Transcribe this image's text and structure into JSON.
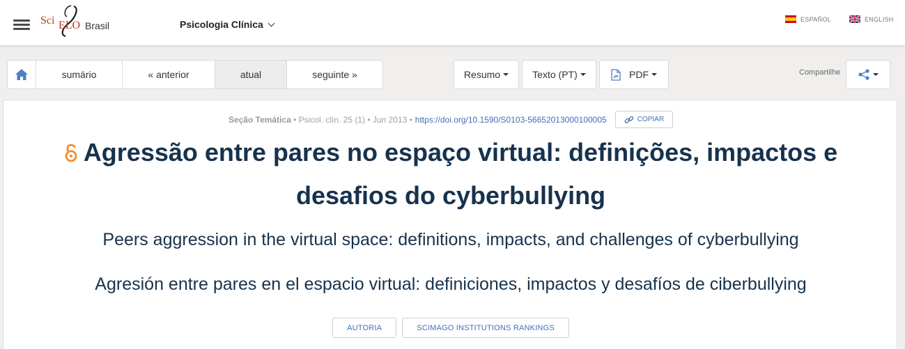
{
  "header": {
    "logo": {
      "sci": "Sci",
      "elo": "ELO",
      "country": "Brasil"
    },
    "journal": "Psicologia Clínica",
    "languages": [
      {
        "label": "ESPAÑOL",
        "flag": "es-flag-icon"
      },
      {
        "label": "ENGLISH",
        "flag": "uk-flag-icon"
      }
    ]
  },
  "nav": {
    "home_icon": "home-icon",
    "sumario": "sumário",
    "anterior": "« anterior",
    "atual": "atual",
    "seguinte": "seguinte »"
  },
  "toolbar": {
    "resumo": "Resumo",
    "texto": "Texto (PT)",
    "pdf": "PDF",
    "pdf_icon": "pdf-icon",
    "share_label": "Compartilhe",
    "share_icon": "share-icon"
  },
  "article": {
    "section": "Seção Temática",
    "citation": " • Psicol. clín. 25 (1) • Jun 2013 •",
    "doi": "https://doi.org/10.1590/S0103-56652013000100005",
    "copy_label": "COPIAR",
    "title": "Agressão entre pares no espaço virtual: definições, impactos e desafios do cyberbullying",
    "title_en": "Peers aggression in the virtual space: definitions, impacts, and challenges of cyberbullying",
    "title_es": "Agresión entre pares en el espacio virtual: definiciones, impactos y desafíos de ciberbullying",
    "buttons": [
      "AUTORIA",
      "SCIMAGO INSTITUTIONS RANKINGS"
    ]
  },
  "colors": {
    "title": "#17324d",
    "link": "#3f70b5",
    "open_access": "#f28c28",
    "brand": "#c0392b"
  }
}
